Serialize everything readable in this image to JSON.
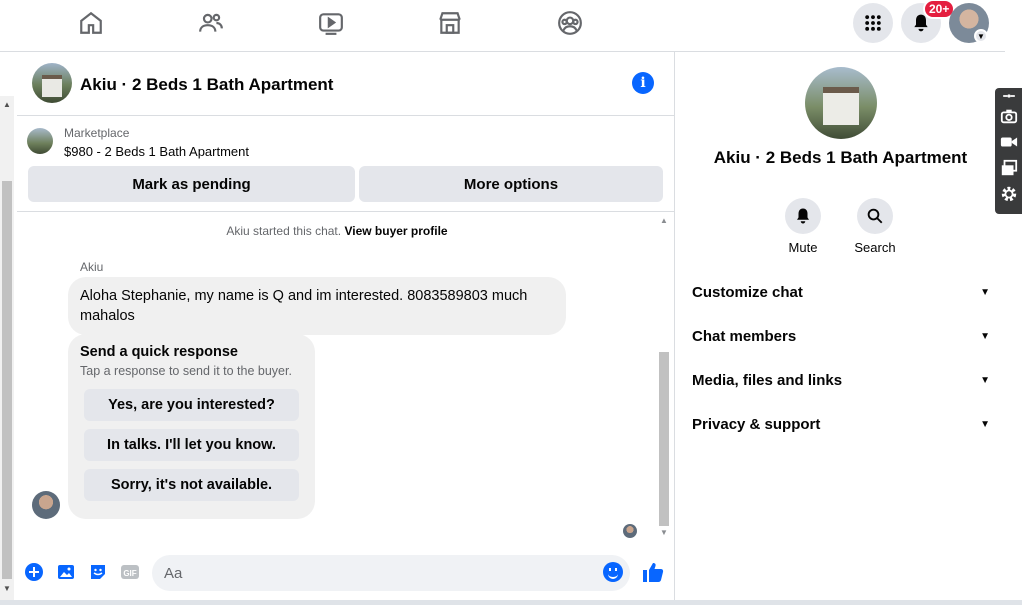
{
  "topnav": {
    "icons": [
      "home-icon",
      "friends-icon",
      "watch-icon",
      "marketplace-icon",
      "groups-icon"
    ],
    "notifications_badge": "20+",
    "menu_icon": "grid-menu-icon",
    "notifications_icon": "bell-icon"
  },
  "chat": {
    "title": "Akiu · 2 Beds 1 Bath Apartment",
    "marketplace_label": "Marketplace",
    "listing": "$980 - 2 Beds 1 Bath Apartment",
    "mark_pending": "Mark as pending",
    "more_options": "More options",
    "started_prefix": "Akiu started this chat.",
    "view_profile": "View buyer profile",
    "sender": "Akiu",
    "message": "Aloha Stephanie, my name is Q and im interested. 8083589803 much mahalos",
    "quick_title": "Send a quick response",
    "quick_sub": "Tap a response to send it to the buyer.",
    "quick_replies": [
      "Yes, are you interested?",
      "In talks. I'll let you know.",
      "Sorry, it's not available."
    ],
    "input_placeholder": "Aa"
  },
  "info_panel": {
    "name": "Akiu · 2 Beds 1 Bath Apartment",
    "mute": "Mute",
    "search": "Search",
    "sections": [
      "Customize chat",
      "Chat members",
      "Media, files and links",
      "Privacy & support"
    ]
  },
  "colors": {
    "accent": "#0866ff",
    "badge": "#e41e3f",
    "button_bg": "#e4e6eb",
    "bubble_bg": "#f0f0f0"
  }
}
